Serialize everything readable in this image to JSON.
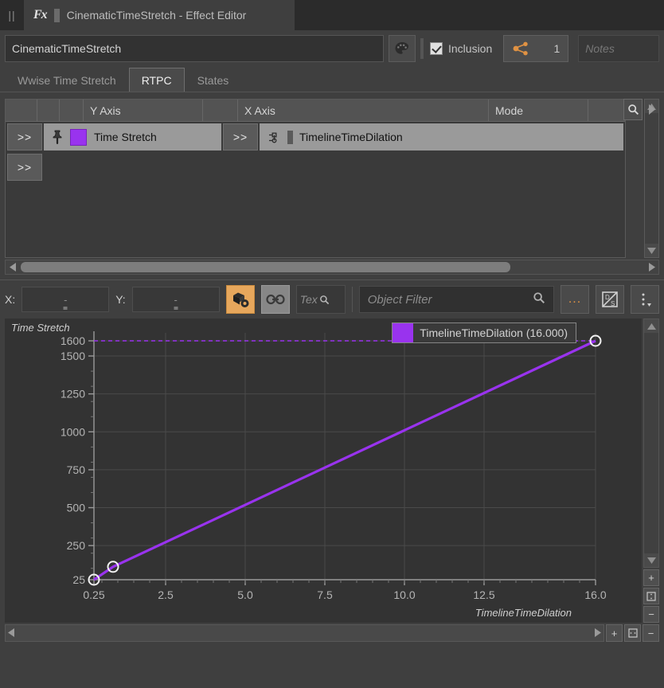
{
  "window": {
    "tab_title": "CinematicTimeStretch - Effect Editor",
    "fx_icon": "fx-icon",
    "drag_handle": "||"
  },
  "namebar": {
    "name_value": "CinematicTimeStretch",
    "palette_icon": "palette-icon",
    "inclusion_label": "Inclusion",
    "inclusion_checked": true,
    "share_icon": "share-nodes-icon",
    "share_count": "1",
    "notes_placeholder": "Notes"
  },
  "tabs": [
    {
      "label": "Wwise Time Stretch",
      "active": false
    },
    {
      "label": "RTPC",
      "active": true
    },
    {
      "label": "States",
      "active": false
    }
  ],
  "rtpc_table": {
    "headers": [
      "",
      "",
      "",
      "Y Axis",
      "",
      "X Axis",
      "Mode",
      ""
    ],
    "search_icon": "search-icon",
    "expand_icon": "expand-right-icon",
    "rows": [
      {
        "expand_label": ">>",
        "pin_icon": "pin-icon",
        "color": "#9933ee",
        "y_axis": "Time Stretch",
        "x_expand_label": ">>",
        "x_icon": "rtpc-game-parameter-icon",
        "x_axis": "TimelineTimeDilation",
        "mode": ""
      }
    ],
    "new_row_label": ">>"
  },
  "controls": {
    "x_label": "X:",
    "x_value": "-",
    "y_label": "Y:",
    "y_value": "-",
    "edit_icon": "edit-curve-icon",
    "link_icon": "link-icon",
    "tex_label": "Tex",
    "tex_icon": "search-icon",
    "object_filter_placeholder": "Object Filter",
    "object_filter_icon": "search-icon",
    "more_label": "...",
    "vs_icon": "visual-studio-icon",
    "menu_icon": "more-options-icon"
  },
  "graph": {
    "title": "Time Stretch",
    "legend_label": "TimelineTimeDilation (16.000)",
    "legend_color": "#9933ee",
    "xaxis_title": "TimelineTimeDilation",
    "zoom_in": "+",
    "zoom_fit": "fit",
    "zoom_out": "−"
  },
  "chart_data": {
    "type": "line",
    "title": "Time Stretch",
    "xlabel": "TimelineTimeDilation",
    "ylabel": "Time Stretch",
    "xlim": [
      0.25,
      16.0
    ],
    "ylim": [
      25,
      1600
    ],
    "xticks": [
      "0.25",
      "2.5",
      "5.0",
      "7.5",
      "10.0",
      "12.5",
      "16.0"
    ],
    "xtick_values": [
      0.25,
      2.5,
      5.0,
      7.5,
      10.0,
      12.5,
      16.0
    ],
    "yticks": [
      "25",
      "250",
      "500",
      "750",
      "1000",
      "1250",
      "1500",
      "1600"
    ],
    "ytick_values": [
      25,
      250,
      500,
      750,
      1000,
      1250,
      1500,
      1600
    ],
    "grid": true,
    "legend_position": "top-right",
    "series": [
      {
        "name": "TimelineTimeDilation (16.000)",
        "color": "#9933ee",
        "points": [
          {
            "x": 0.25,
            "y": 25
          },
          {
            "x": 0.85,
            "y": 110
          },
          {
            "x": 16.0,
            "y": 1600
          }
        ]
      }
    ],
    "annotations": [
      {
        "type": "hline",
        "y": 1600,
        "style": "dashed",
        "color": "#9933ee"
      },
      {
        "type": "marker",
        "x": 16.0,
        "y": 1600,
        "label": "current-value"
      }
    ]
  }
}
